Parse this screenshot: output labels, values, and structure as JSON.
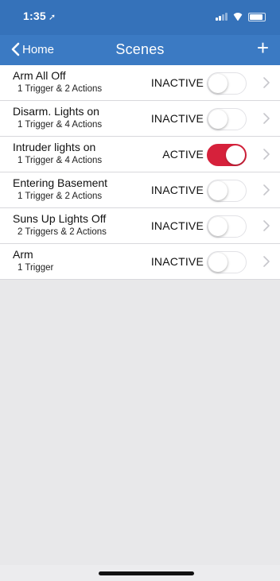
{
  "status_bar": {
    "time": "1:35",
    "location_glyph": "➚"
  },
  "nav": {
    "back_label": "Home",
    "title": "Scenes",
    "add_label": "+"
  },
  "colors": {
    "header": "#3b7ac3",
    "active_toggle": "#d6213b"
  },
  "scenes": [
    {
      "name": "Arm All Off",
      "detail": "1 Trigger & 2 Actions",
      "state": "INACTIVE",
      "enabled": false
    },
    {
      "name": "Disarm. Lights on",
      "detail": "1 Trigger & 4 Actions",
      "state": "INACTIVE",
      "enabled": false
    },
    {
      "name": "Intruder lights on",
      "detail": "1 Trigger & 4 Actions",
      "state": "ACTIVE",
      "enabled": true
    },
    {
      "name": "Entering Basement",
      "detail": "1 Trigger & 2 Actions",
      "state": "INACTIVE",
      "enabled": false
    },
    {
      "name": "Suns Up Lights Off",
      "detail": "2 Triggers & 2 Actions",
      "state": "INACTIVE",
      "enabled": false
    },
    {
      "name": "Arm",
      "detail": "1 Trigger",
      "state": "INACTIVE",
      "enabled": false
    }
  ]
}
